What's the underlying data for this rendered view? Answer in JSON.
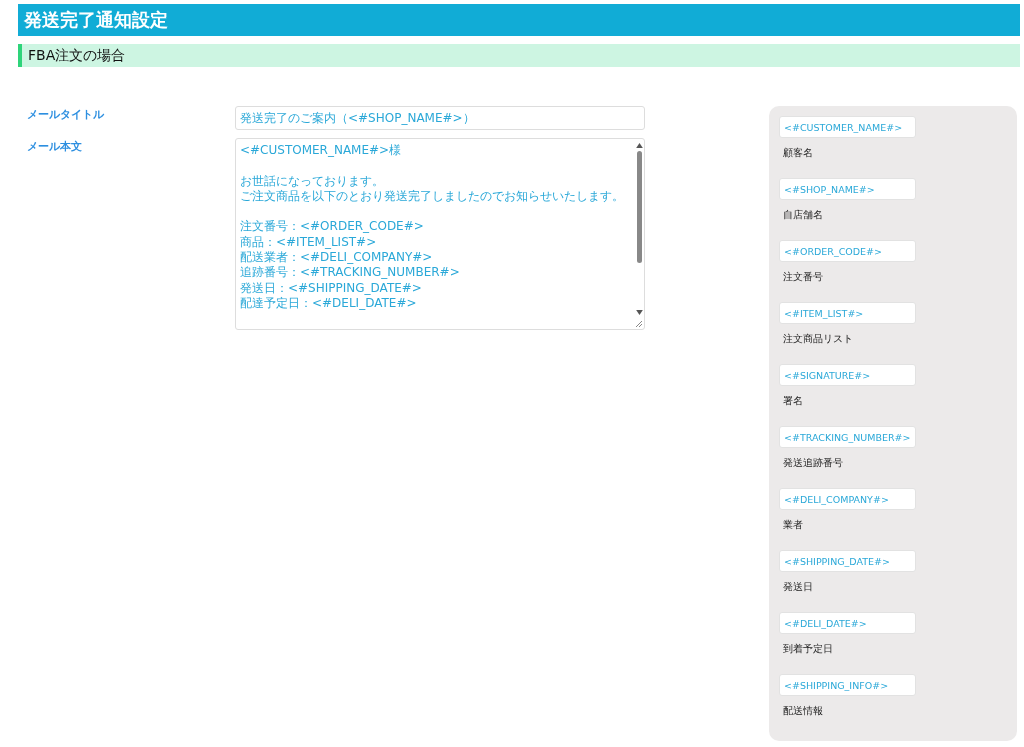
{
  "page_title": "発送完了通知設定",
  "section_title": "FBA注文の場合",
  "form": {
    "fields": [
      {
        "kind": "input",
        "label": "メールタイトル",
        "value": "発送完了のご案内（<#SHOP_NAME#>）"
      },
      {
        "kind": "textarea",
        "label": "メール本文",
        "paragraphs": [
          [
            "<#CUSTOMER_NAME#>様"
          ],
          [
            "お世話になっております。",
            "ご注文商品を以下のとおり発送完了しましたのでお知らせいたします。"
          ],
          [
            "注文番号：<#ORDER_CODE#>",
            "商品：<#ITEM_LIST#>",
            "配送業者：<#DELI_COMPANY#>",
            "追跡番号：<#TRACKING_NUMBER#>",
            "発送日：<#SHIPPING_DATE#>",
            "配達予定日：<#DELI_DATE#>"
          ]
        ]
      }
    ]
  },
  "tags": [
    {
      "tag": "<#CUSTOMER_NAME#>",
      "description": "顧客名"
    },
    {
      "tag": "<#SHOP_NAME#>",
      "description": "自店舗名"
    },
    {
      "tag": "<#ORDER_CODE#>",
      "description": "注文番号"
    },
    {
      "tag": "<#ITEM_LIST#>",
      "description": "注文商品リスト"
    },
    {
      "tag": "<#SIGNATURE#>",
      "description": "署名"
    },
    {
      "tag": "<#TRACKING_NUMBER#>",
      "description": "発送追跡番号"
    },
    {
      "tag": "<#DELI_COMPANY#>",
      "description": "業者"
    },
    {
      "tag": "<#SHIPPING_DATE#>",
      "description": "発送日"
    },
    {
      "tag": "<#DELI_DATE#>",
      "description": "到着予定日"
    },
    {
      "tag": "<#SHIPPING_INFO#>",
      "description": "配送情報"
    }
  ]
}
